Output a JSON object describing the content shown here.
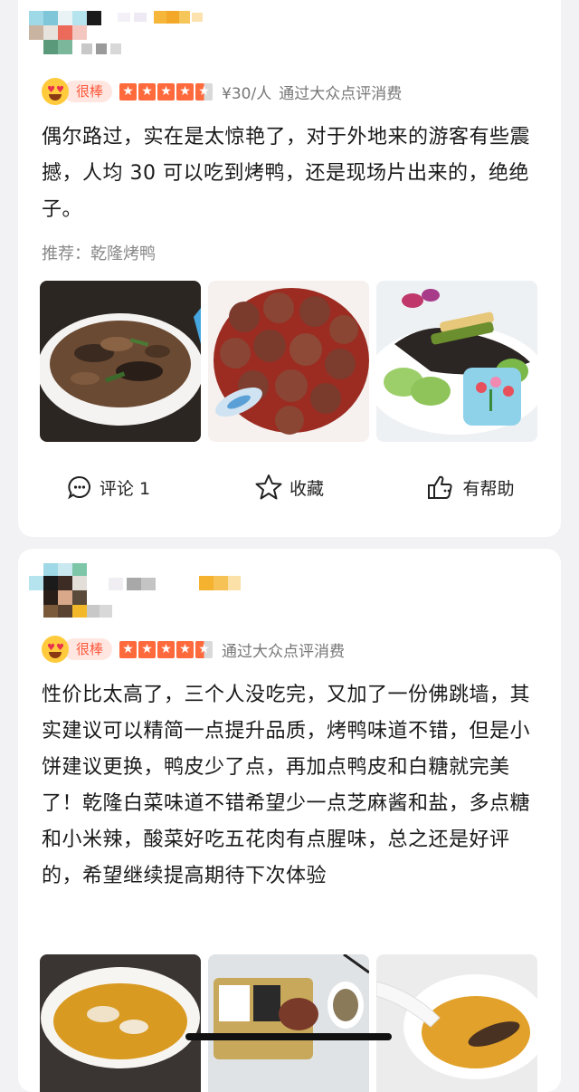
{
  "reviews": [
    {
      "user": {
        "name": "",
        "level": ""
      },
      "rating": {
        "badge": "很棒",
        "stars": 4.5
      },
      "price": "¥30/人",
      "source": "通过大众点评消费",
      "text": "偶尔路过，实在是太惊艳了，对于外地来的游客有些震撼，人均 30 可以吃到烤鸭，还是现场片出来的，绝绝子。",
      "recommend": "推荐：乾隆烤鸭",
      "photos": [
        "food-photo-1",
        "food-photo-2",
        "food-photo-3"
      ],
      "actions": {
        "comment": "评论 1",
        "favorite": "收藏",
        "helpful": "有帮助"
      }
    },
    {
      "user": {
        "name": "",
        "level": ""
      },
      "rating": {
        "badge": "很棒",
        "stars": 4.5
      },
      "source": "通过大众点评消费",
      "text": "性价比太高了，三个人没吃完，又加了一份佛跳墙，其实建议可以精简一点提升品质，烤鸭味道不错，但是小饼建议更换，鸭皮少了点，再加点鸭皮和白糖就完美了！乾隆白菜味道不错希望少一点芝麻酱和盐，多点糖和小米辣，酸菜好吃五花肉有点腥味，总之还是好评的，希望继续提高期待下次体验",
      "photos": [
        "food-photo-4",
        "food-photo-5",
        "food-photo-6"
      ]
    }
  ],
  "colors": {
    "accent": "#ff5a3c",
    "star": "#ff6a3d",
    "background": "#f2f2f4"
  }
}
